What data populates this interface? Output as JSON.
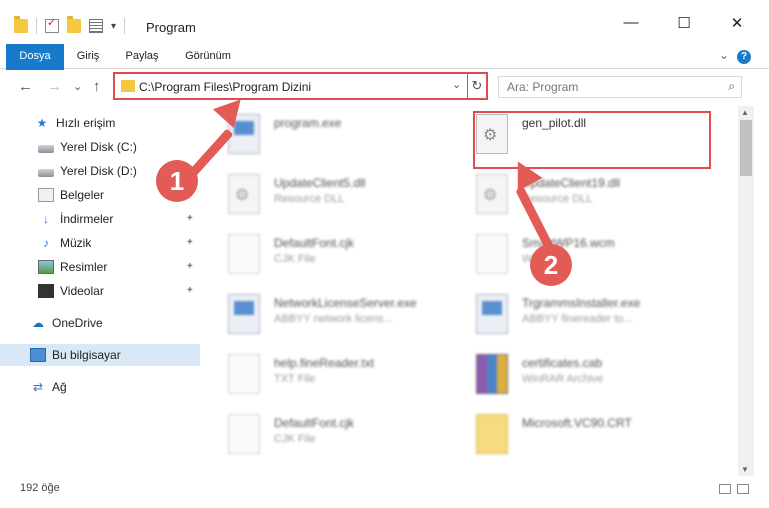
{
  "window": {
    "title": "Program",
    "minimize_glyph": "—",
    "maximize_glyph": "☐",
    "close_glyph": "✕"
  },
  "ribbon": {
    "tabs": [
      "Dosya",
      "Giriş",
      "Paylaş",
      "Görünüm"
    ],
    "help_glyph": "?",
    "chevron_glyph": "⌄"
  },
  "nav": {
    "back_glyph": "←",
    "forward_glyph": "→",
    "recent_glyph": "⌄",
    "up_glyph": "↑"
  },
  "address": {
    "path": "C:\\Program Files\\Program Dizini",
    "dropdown_glyph": "⌄",
    "refresh_glyph": "↻"
  },
  "search": {
    "placeholder": "Ara: Program",
    "icon_glyph": "⌕"
  },
  "sidebar": {
    "items": [
      {
        "label": "Hızlı erişim",
        "icon": "star-icon",
        "pinned": false
      },
      {
        "label": "Yerel Disk (C:)",
        "icon": "drive-icon",
        "pinned": false
      },
      {
        "label": "Yerel Disk (D:)",
        "icon": "drive-icon",
        "pinned": false
      },
      {
        "label": "Belgeler",
        "icon": "documents-icon",
        "pinned": true
      },
      {
        "label": "İndirmeler",
        "icon": "downloads-icon",
        "pinned": true
      },
      {
        "label": "Müzik",
        "icon": "music-icon",
        "pinned": true
      },
      {
        "label": "Resimler",
        "icon": "pictures-icon",
        "pinned": true
      },
      {
        "label": "Videolar",
        "icon": "videos-icon",
        "pinned": true
      },
      {
        "label": "OneDrive",
        "icon": "onedrive-icon",
        "pinned": false
      },
      {
        "label": "Bu bilgisayar",
        "icon": "this-pc-icon",
        "pinned": false,
        "selected": true
      },
      {
        "label": "Ağ",
        "icon": "network-icon",
        "pinned": false
      }
    ],
    "pin_glyph": "📌"
  },
  "files": [
    {
      "name": "program.exe",
      "desc": "",
      "icon": "exe-icon",
      "blurred": true
    },
    {
      "name": "gen_pilot.dll",
      "desc": "",
      "icon": "dll-icon",
      "blurred": false,
      "highlighted": true
    },
    {
      "name": "UpdateClient5.dll",
      "desc": "Resource DLL",
      "icon": "dll-icon",
      "blurred": true
    },
    {
      "name": "UpdateClient19.dll",
      "desc": "Resource DLL",
      "icon": "dll-icon",
      "blurred": true
    },
    {
      "name": "DefaultFont.cjk",
      "desc": "CJK File",
      "icon": "doc-icon",
      "blurred": true
    },
    {
      "name": "SmartWP16.wcm",
      "desc": "WCM File",
      "icon": "doc-icon",
      "blurred": true
    },
    {
      "name": "NetworkLicenseServer.exe",
      "desc": "ABBYY network licens...",
      "icon": "exe-icon",
      "blurred": true
    },
    {
      "name": "TrgrammsInstaller.exe",
      "desc": "ABBYY finereader to...",
      "icon": "exe-icon",
      "blurred": true
    },
    {
      "name": "help.fineReader.txt",
      "desc": "TXT File",
      "icon": "doc-icon",
      "blurred": true
    },
    {
      "name": "certificates.cab",
      "desc": "WinRAR Archive",
      "icon": "cab-icon",
      "blurred": true
    },
    {
      "name": "DefaultFont.cjk",
      "desc": "CJK File",
      "icon": "doc-icon",
      "blurred": true
    },
    {
      "name": "Microsoft.VC90.CRT",
      "desc": "",
      "icon": "folder-icon",
      "blurred": true
    }
  ],
  "status": {
    "item_count": "192 öğe"
  },
  "callouts": {
    "one": "1",
    "two": "2"
  },
  "colors": {
    "accent": "#1979ca",
    "annotation_red": "#e25b55",
    "selection": "#d9e8f7"
  }
}
